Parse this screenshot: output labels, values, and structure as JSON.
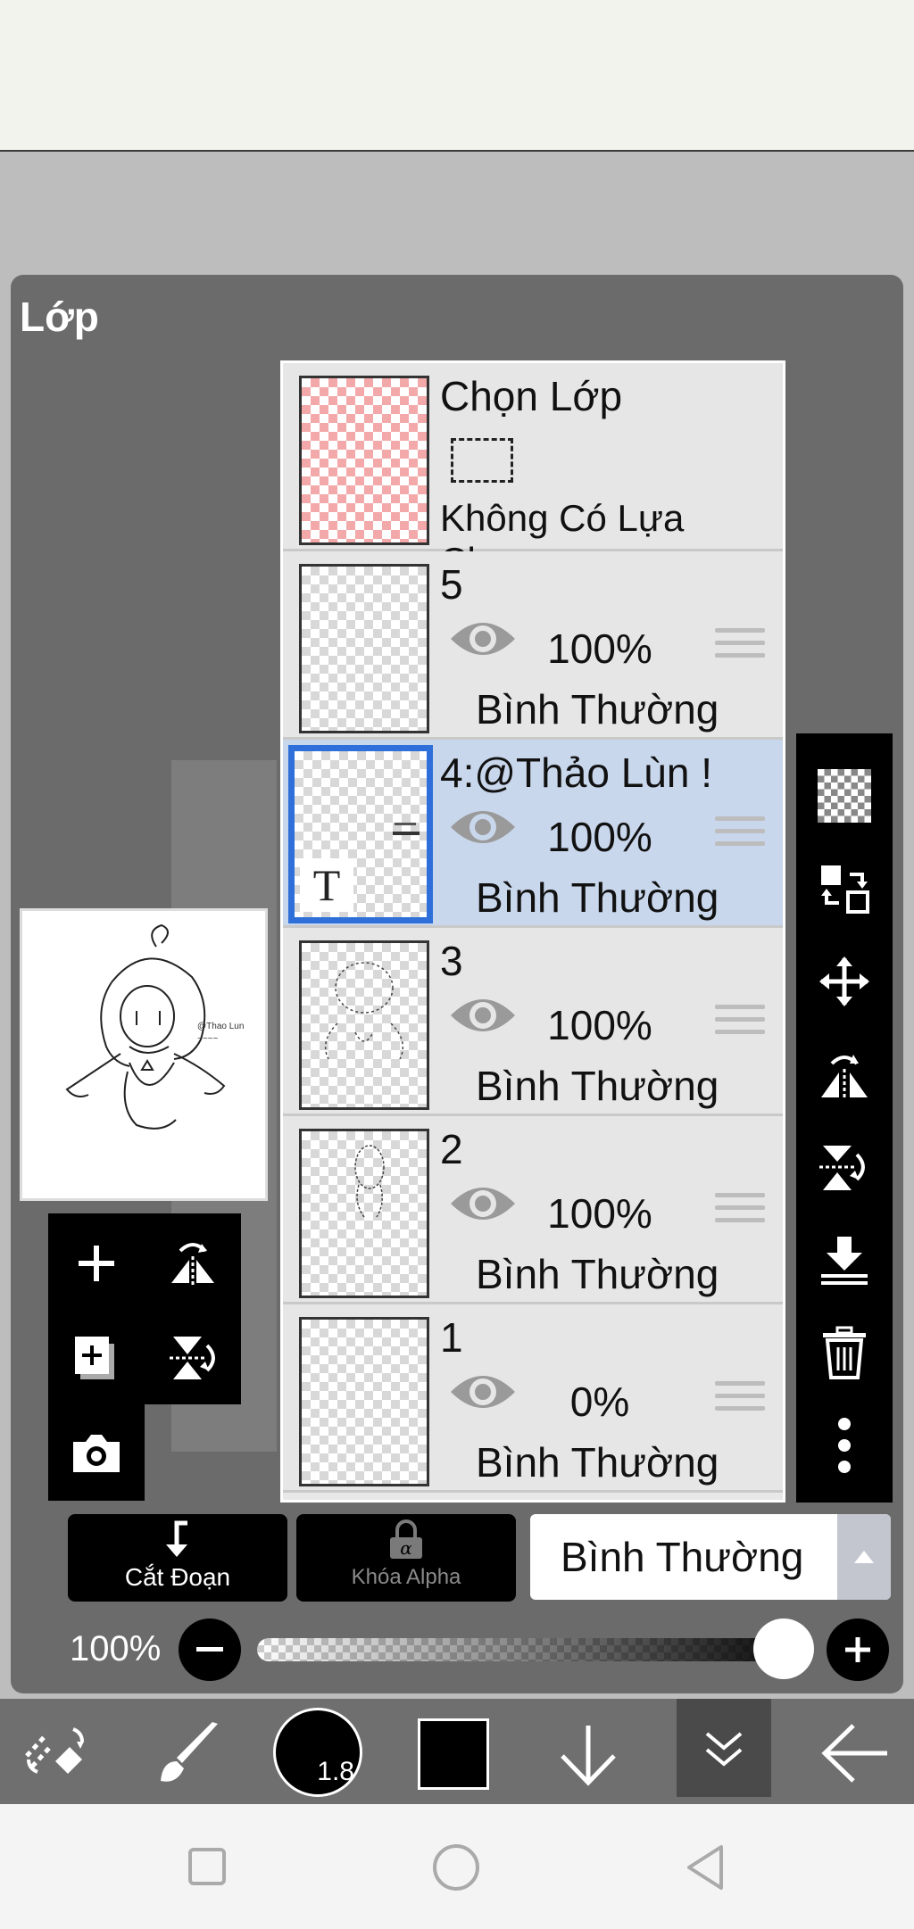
{
  "panel": {
    "title": "Lớp"
  },
  "selection_layer": {
    "name": "Chọn Lớp",
    "status": "Không Có Lựa Chọn"
  },
  "layers": [
    {
      "name": "5",
      "opacity": "100%",
      "blend": "Bình Thường",
      "selected": false
    },
    {
      "name": "4:@Thảo Lùn !",
      "opacity": "100%",
      "blend": "Bình Thường",
      "selected": true,
      "text_badge": "T"
    },
    {
      "name": "3",
      "opacity": "100%",
      "blend": "Bình Thường",
      "selected": false
    },
    {
      "name": "2",
      "opacity": "100%",
      "blend": "Bình Thường",
      "selected": false
    },
    {
      "name": "1",
      "opacity": "0%",
      "blend": "Bình Thường",
      "selected": false
    }
  ],
  "actions": {
    "clip_label": "Cắt Đoạn",
    "alpha_lock_label": "Khóa Alpha"
  },
  "blend_mode": {
    "selected": "Bình Thường"
  },
  "opacity": {
    "label": "100%",
    "value": 1.0
  },
  "toolbar": {
    "brush_size": "1.8",
    "color": "#000000"
  },
  "colors": {
    "selected_border": "#2f6fd9",
    "selected_row": "#c9d7ec",
    "panel_bg": "#6b6b6b"
  },
  "icons": {
    "right_tools": [
      "transparency-icon",
      "swap-layers-icon",
      "move-icon",
      "flip-horizontal-icon",
      "flip-vertical-icon",
      "merge-down-icon",
      "trash-icon",
      "more-icon"
    ],
    "left_tools": [
      "add-layer-icon",
      "flip-horizontal-icon",
      "add-copy-layer-icon",
      "flip-vertical-icon",
      "camera-icon"
    ],
    "bottom": [
      "transform-icon",
      "brush-icon",
      "brush-size-icon",
      "color-icon",
      "down-arrow-icon",
      "collapse-icon",
      "back-arrow-icon"
    ],
    "nav": [
      "square-icon",
      "circle-icon",
      "triangle-back-icon"
    ]
  }
}
